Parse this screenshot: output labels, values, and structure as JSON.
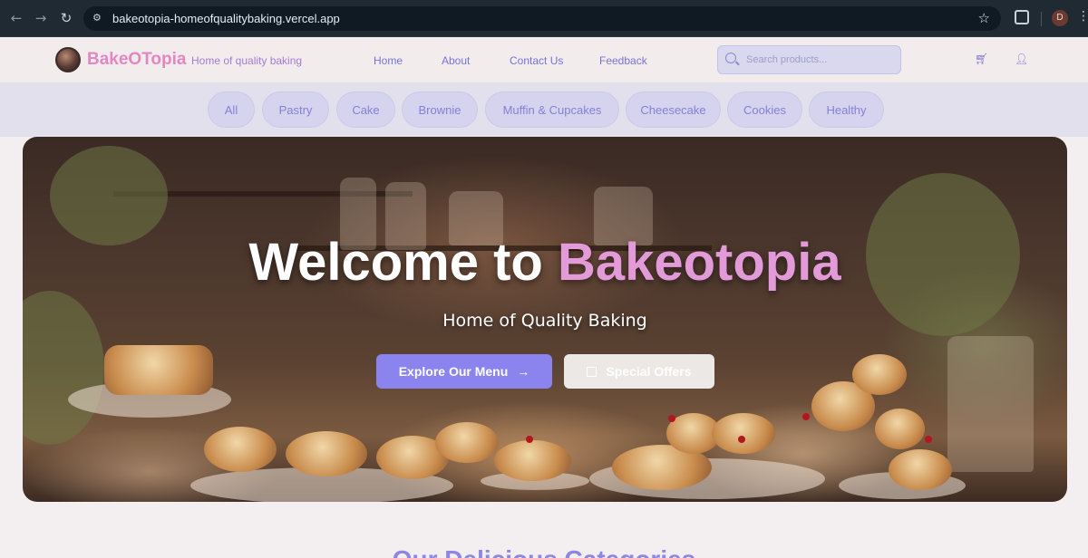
{
  "browser": {
    "url": "bakeotopia-homeofqualitybaking.vercel.app",
    "profile_initial": "D",
    "icons": [
      "back-arrow-icon",
      "forward-arrow-icon",
      "reload-icon",
      "site-settings-icon",
      "star-icon",
      "extensions-icon",
      "menu-icon"
    ]
  },
  "header": {
    "brand": "BakeOTopia",
    "tagline": "Home of quality baking",
    "nav": [
      "Home",
      "About",
      "Contact Us",
      "Feedback"
    ],
    "search_placeholder": "Search products...",
    "icons": [
      "search-icon",
      "cart-icon",
      "user-icon"
    ]
  },
  "categories": [
    "All",
    "Pastry",
    "Cake",
    "Brownie",
    "Muffin & Cupcakes",
    "Cheesecake",
    "Cookies",
    "Healthy"
  ],
  "hero": {
    "title_main": "Welcome to ",
    "title_accent": "Bakeotopia",
    "subtitle": "Home of Quality Baking",
    "primary_button": "Explore Our Menu",
    "secondary_button": "Special Offers"
  },
  "section": {
    "title": "Our Delicious Categories"
  },
  "colors": {
    "brand": "#e387c2",
    "accent_purple": "#8b84ee",
    "nav_text": "#7772d6",
    "hero_accent": "#e29ad8"
  }
}
